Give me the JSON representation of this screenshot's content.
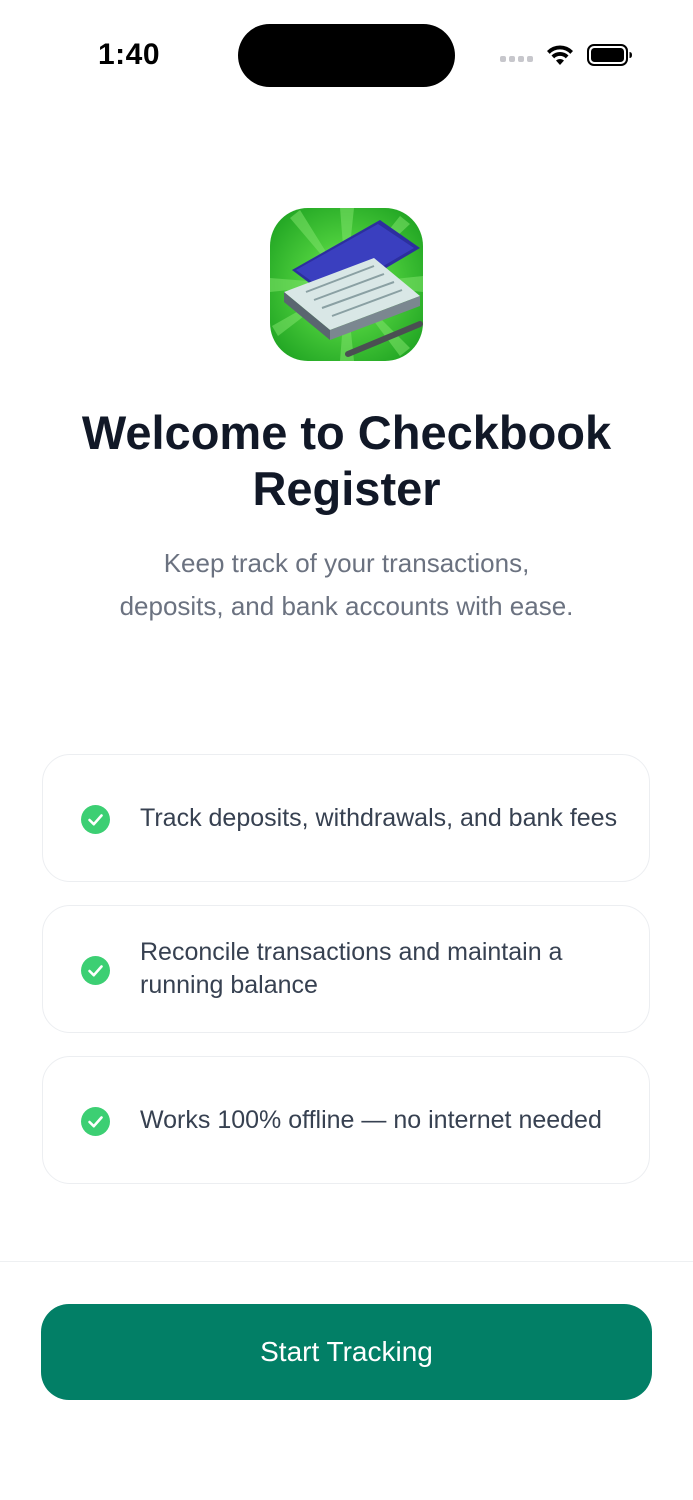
{
  "status_bar": {
    "time": "1:40"
  },
  "app_icon": {
    "name": "checkbook-icon"
  },
  "welcome": {
    "title": "Welcome to Checkbook Register",
    "subtitle": "Keep track of your transactions, deposits, and bank accounts with ease."
  },
  "features": [
    {
      "text": "Track deposits, withdrawals, and bank fees",
      "icon": "check-circle-icon"
    },
    {
      "text": "Reconcile transactions and maintain a running balance",
      "icon": "check-circle-icon"
    },
    {
      "text": "Works 100% offline — no internet needed",
      "icon": "check-circle-icon"
    }
  ],
  "cta": {
    "label": "Start Tracking"
  },
  "colors": {
    "accent": "#027f66",
    "check": "#3ccf73",
    "title": "#111827",
    "subtitle": "#6b7280"
  }
}
